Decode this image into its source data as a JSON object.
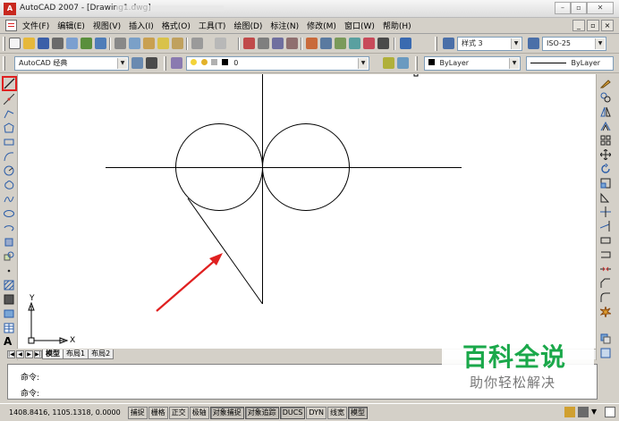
{
  "window": {
    "title": "AutoCAD 2007 - [Drawing1.dwg]",
    "minimize": "–",
    "maximize": "▫",
    "close": "✕"
  },
  "menu": {
    "items": [
      {
        "label": "文件(F)"
      },
      {
        "label": "编辑(E)"
      },
      {
        "label": "视图(V)"
      },
      {
        "label": "插入(I)"
      },
      {
        "label": "格式(O)"
      },
      {
        "label": "工具(T)"
      },
      {
        "label": "绘图(D)"
      },
      {
        "label": "标注(N)"
      },
      {
        "label": "修改(M)"
      },
      {
        "label": "窗口(W)"
      },
      {
        "label": "帮助(H)"
      }
    ],
    "doc_min": "_",
    "doc_restore": "▫",
    "doc_close": "×"
  },
  "toolbar": {
    "text_style": "样式 3",
    "dim_style": "ISO-25",
    "workspace": "AutoCAD 经典",
    "layer": "0",
    "color": "ByLayer",
    "linetype": "ByLayer"
  },
  "canvas": {
    "ucs_y": "Y",
    "ucs_x": "X"
  },
  "layout_tabs": {
    "nav": [
      "|◀",
      "◀",
      "▶",
      "▶|"
    ],
    "tabs": [
      {
        "label": "模型",
        "active": true
      },
      {
        "label": "布局1",
        "active": false
      },
      {
        "label": "布局2",
        "active": false
      }
    ]
  },
  "command": {
    "line1": "命令:",
    "line2": "命令:"
  },
  "status": {
    "coords": "1408.8416, 1105.1318, 0.0000",
    "buttons": [
      {
        "label": "捕捉",
        "on": false
      },
      {
        "label": "栅格",
        "on": false
      },
      {
        "label": "正交",
        "on": false
      },
      {
        "label": "极轴",
        "on": false
      },
      {
        "label": "对象捕捉",
        "on": true
      },
      {
        "label": "对象追踪",
        "on": true
      },
      {
        "label": "DUCS",
        "on": true
      },
      {
        "label": "DYN",
        "on": false
      },
      {
        "label": "线宽",
        "on": false
      },
      {
        "label": "模型",
        "on": true
      }
    ]
  },
  "watermark": {
    "title": "百科全说",
    "subtitle": "助你轻松解决"
  },
  "colors": {
    "accent_red": "#e02020",
    "watermark_green": "#1aa84a"
  }
}
